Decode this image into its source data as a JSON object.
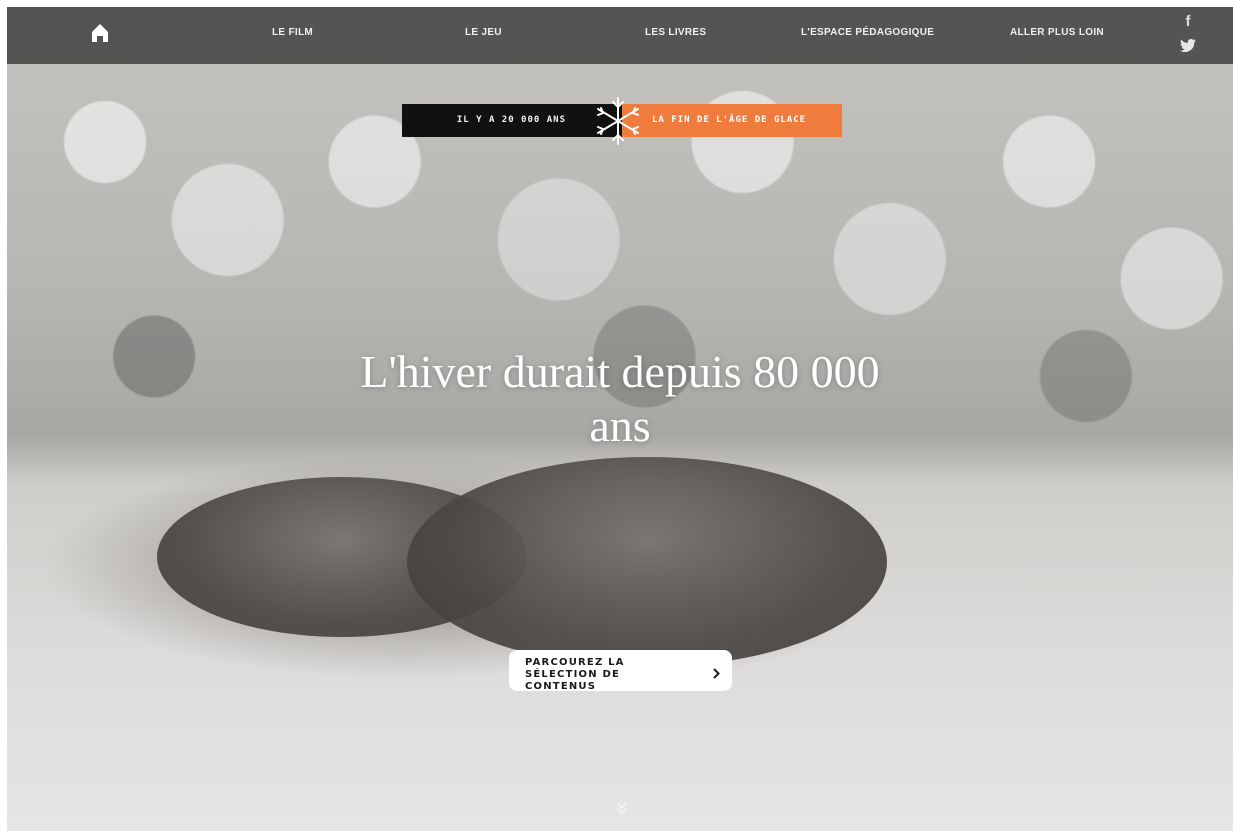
{
  "nav": {
    "home_icon": "home-icon",
    "items": [
      {
        "label": "LE FILM"
      },
      {
        "label": "LE JEU"
      },
      {
        "label": "LES LIVRES"
      },
      {
        "label": "L'ESPACE PÉDAGOGIQUE"
      },
      {
        "label": "ALLER PLUS LOIN"
      }
    ],
    "social": {
      "facebook": "f",
      "twitter_icon": "twitter-icon"
    }
  },
  "timeline": {
    "left_label": "IL Y A 20 000 ANS",
    "right_label": "LA FIN DE L'ÂGE DE GLACE",
    "icon": "snowflake-icon",
    "accent_color": "#ef7b3c"
  },
  "hero": {
    "headline": "L'hiver durait depuis 80 000 ans"
  },
  "cta": {
    "label": "PARCOUREZ LA SÉLECTION DE CONTENUS",
    "icon": "chevron-right-icon"
  },
  "scroll_icon": "double-chevron-down-icon"
}
